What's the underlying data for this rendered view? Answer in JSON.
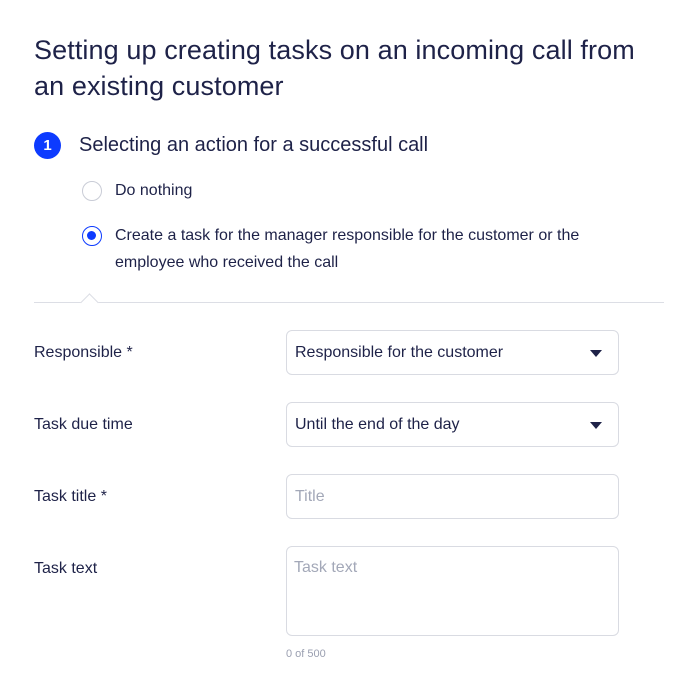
{
  "dialog": {
    "title": "Setting up creating tasks on an incoming call from an existing customer"
  },
  "step": {
    "number": "1",
    "title": "Selecting an action for a successful call",
    "options": [
      {
        "label": "Do nothing",
        "checked": false
      },
      {
        "label": "Create a task for the manager responsible for the customer or the employee who received the call",
        "checked": true
      }
    ]
  },
  "form": {
    "responsible": {
      "label": "Responsible *",
      "value": "Responsible for the customer"
    },
    "due_time": {
      "label": "Task due time",
      "value": "Until the end of the day"
    },
    "task_title": {
      "label": "Task title *",
      "value": "",
      "placeholder": "Title"
    },
    "task_text": {
      "label": "Task text",
      "value": "",
      "placeholder": "Task text",
      "counter": "0 of 500"
    }
  },
  "colors": {
    "accent": "#0d3bff",
    "text": "#1e2248",
    "placeholder": "#a3a8b8",
    "border": "#d9dbe2"
  },
  "icons": {
    "select_caret": "caret-down-icon"
  }
}
